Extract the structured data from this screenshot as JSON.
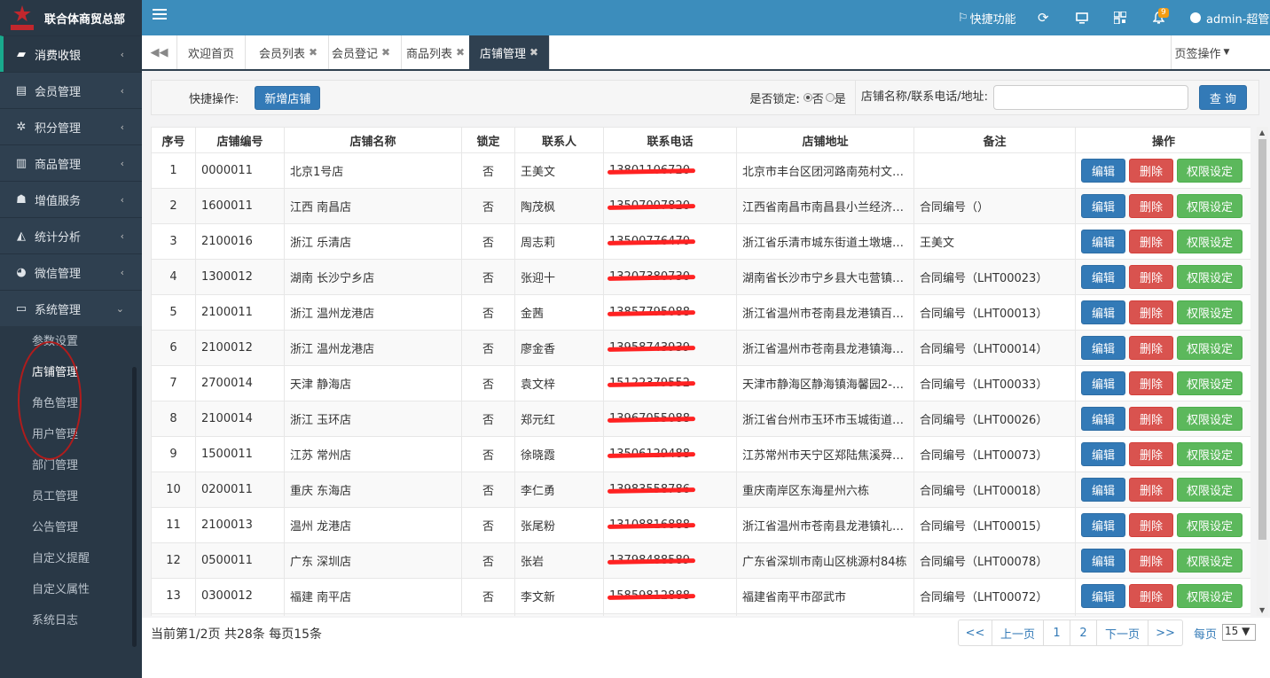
{
  "brand": {
    "name": "联合体商贸总部"
  },
  "topbar": {
    "quick": "快捷功能",
    "badge": "9",
    "user": "admin-超管"
  },
  "sidebar": {
    "items": [
      {
        "label": "消费收银",
        "icon": "bag-icon",
        "active": true
      },
      {
        "label": "会员管理",
        "icon": "database-icon"
      },
      {
        "label": "积分管理",
        "icon": "gear-icon"
      },
      {
        "label": "商品管理",
        "icon": "barcode-icon"
      },
      {
        "label": "增值服务",
        "icon": "thumbs-up-icon"
      },
      {
        "label": "统计分析",
        "icon": "area-chart-icon"
      },
      {
        "label": "微信管理",
        "icon": "wechat-icon"
      },
      {
        "label": "系统管理",
        "icon": "desktop-icon",
        "expanded": true
      }
    ],
    "sub": [
      "参数设置",
      "店铺管理",
      "角色管理",
      "用户管理",
      "部门管理",
      "员工管理",
      "公告管理",
      "自定义提醒",
      "自定义属性",
      "系统日志"
    ]
  },
  "tabs": [
    "欢迎首页",
    "会员列表",
    "会员登记",
    "商品列表",
    "店铺管理"
  ],
  "tab_ops": "页签操作",
  "toolbar": {
    "quick_label": "快捷操作:",
    "add_btn": "新增店铺",
    "lock_label": "是否锁定:",
    "no": "否",
    "yes": "是",
    "search_label": "店铺名称/联系电话/地址:",
    "search_value": "",
    "query_btn": "查 询"
  },
  "table": {
    "headers": [
      "序号",
      "店铺编号",
      "店铺名称",
      "锁定",
      "联系人",
      "联系电话",
      "店铺地址",
      "备注",
      "操作"
    ],
    "rows": [
      {
        "no": "1",
        "code": "0000011",
        "name": "北京1号店",
        "lock": "否",
        "contact": "王美文",
        "phone": "13801106720",
        "addr": "北京市丰台区团河路南苑村文化…",
        "note": ""
      },
      {
        "no": "2",
        "code": "1600011",
        "name": "江西 南昌店",
        "lock": "否",
        "contact": "陶茂枫",
        "phone": "13507007820",
        "addr": "江西省南昌市南昌县小兰经济开…",
        "note": "合同编号（）"
      },
      {
        "no": "3",
        "code": "2100016",
        "name": "浙江 乐清店",
        "lock": "否",
        "contact": "周志莉",
        "phone": "13500776470",
        "addr": "浙江省乐清市城东街道土墩塘村…",
        "note": "王美文"
      },
      {
        "no": "4",
        "code": "1300012",
        "name": "湖南 长沙宁乡店",
        "lock": "否",
        "contact": "张迎十",
        "phone": "13207380730",
        "addr": "湖南省长沙市宁乡县大屯营镇梅…",
        "note": "合同编号（LHT00023）"
      },
      {
        "no": "5",
        "code": "2100011",
        "name": "浙江 温州龙港店",
        "lock": "否",
        "contact": "金茜",
        "phone": "13857795088",
        "addr": "浙江省温州市苍南县龙港镇百有…",
        "note": "合同编号（LHT00013）"
      },
      {
        "no": "6",
        "code": "2100012",
        "name": "浙江 温州龙港店",
        "lock": "否",
        "contact": "廖金香",
        "phone": "13958743939",
        "addr": "浙江省温州市苍南县龙港镇海港…",
        "note": "合同编号（LHT00014）"
      },
      {
        "no": "7",
        "code": "2700014",
        "name": "天津 静海店",
        "lock": "否",
        "contact": "袁文梓",
        "phone": "15122379552",
        "addr": "天津市静海区静海镇海馨园2-2-501",
        "note": "合同编号（LHT00033）"
      },
      {
        "no": "8",
        "code": "2100014",
        "name": "浙江 玉环店",
        "lock": "否",
        "contact": "郑元红",
        "phone": "13967055088",
        "addr": "浙江省台州市玉环市玉城街道双…",
        "note": "合同编号（LHT00026）"
      },
      {
        "no": "9",
        "code": "1500011",
        "name": "江苏 常州店",
        "lock": "否",
        "contact": "徐晓霞",
        "phone": "13506129488",
        "addr": "江苏常州市天宁区郑陆焦溪舜苑5…",
        "note": "合同编号（LHT00073）"
      },
      {
        "no": "10",
        "code": "0200011",
        "name": "重庆 东海店",
        "lock": "否",
        "contact": "李仁勇",
        "phone": "13983558786",
        "addr": "重庆南岸区东海星州六栋",
        "note": "合同编号（LHT00018）"
      },
      {
        "no": "11",
        "code": "2100013",
        "name": "温州 龙港店",
        "lock": "否",
        "contact": "张尾粉",
        "phone": "13108816888",
        "addr": "浙江省温州市苍南县龙港镇礼品…",
        "note": "合同编号（LHT00015）"
      },
      {
        "no": "12",
        "code": "0500011",
        "name": "广东 深圳店",
        "lock": "否",
        "contact": "张岩",
        "phone": "13798488589",
        "addr": "广东省深圳市南山区桃源村84栋",
        "note": "合同编号（LHT00078）"
      },
      {
        "no": "13",
        "code": "0300012",
        "name": "福建 南平店",
        "lock": "否",
        "contact": "李文新",
        "phone": "15859812888",
        "addr": "福建省南平市邵武市",
        "note": "合同编号（LHT00072）"
      },
      {
        "no": "14",
        "code": "",
        "name": "",
        "lock": "",
        "contact": "",
        "phone": "",
        "addr": "",
        "note": ""
      }
    ],
    "actions": {
      "edit": "编辑",
      "delete": "删除",
      "perm": "权限设定"
    }
  },
  "footer": {
    "info": "当前第1/2页 共28条 每页15条",
    "pages": [
      "<<",
      "上一页",
      "1",
      "2",
      "下一页",
      ">>"
    ],
    "per_page_label": "每页",
    "per_page": "15 ▼"
  },
  "colors": {
    "sidebar": "#2f4050",
    "topbar": "#3c8dbc",
    "accent": "#19aa8d",
    "primary": "#337ab7",
    "danger": "#d9534f",
    "success": "#5cb85c"
  }
}
